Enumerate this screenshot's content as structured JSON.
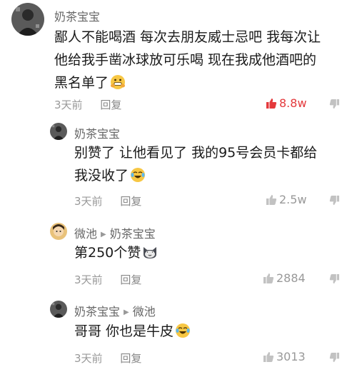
{
  "colors": {
    "accent": "#e4393c",
    "muted": "#999999",
    "text": "#1a1a1a"
  },
  "comments": [
    {
      "avatar_icon": "dark-portrait-avatar",
      "username": "奶茶宝宝",
      "reply_to": "",
      "lines": [
        "鄙人不能喝酒  每次去朋友威士忌吧  我每次让",
        "他给我手凿冰球放可乐喝  现在我成他酒吧的",
        "黑名单了"
      ],
      "emoji": "grimace-hands-emoji",
      "time": "3天前",
      "reply_label": "回复",
      "likes": "8.8w",
      "liked": true
    },
    {
      "avatar_icon": "dark-portrait-avatar",
      "username": "奶茶宝宝",
      "reply_to": "",
      "lines": [
        "别赞了 让他看见了 我的95号会员卡都给",
        "我没收了"
      ],
      "emoji": "tears-of-joy-emoji",
      "time": "3天前",
      "reply_label": "回复",
      "likes": "2.5w",
      "liked": false
    },
    {
      "avatar_icon": "cartoon-avatar",
      "username": "微池",
      "reply_to": "奶茶宝宝",
      "lines": [
        "第250个赞"
      ],
      "emoji": "cat-face-emoji",
      "time": "3天前",
      "reply_label": "回复",
      "likes": "2884",
      "liked": false
    },
    {
      "avatar_icon": "dark-portrait-avatar",
      "username": "奶茶宝宝",
      "reply_to": "微池",
      "lines": [
        "哥哥  你也是牛皮"
      ],
      "emoji": "tears-of-joy-emoji",
      "time": "3天前",
      "reply_label": "回复",
      "likes": "3013",
      "liked": false
    }
  ]
}
